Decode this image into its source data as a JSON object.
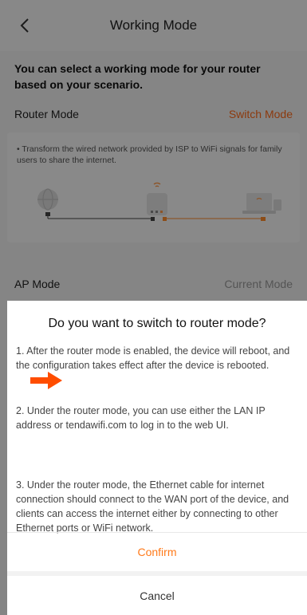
{
  "header": {
    "title": "Working Mode",
    "back_icon": "chevron-left-icon"
  },
  "intro_text": "You can select a working mode for your router based on your scenario.",
  "router_mode": {
    "label": "Router Mode",
    "action": "Switch Mode",
    "description": "• Transform the wired network provided by ISP to WiFi signals for family users to share the internet."
  },
  "ap_mode": {
    "label": "AP Mode",
    "status": "Current Mode"
  },
  "dialog": {
    "title": "Do you want to switch to router mode?",
    "paragraphs": [
      "1. After the router mode is enabled, the device will reboot, and the configuration takes effect after the device is rebooted.",
      "2. Under the router mode, you can use either the LAN IP address or tendawifi.com to log in to the web UI.",
      "3. Under the router mode, the Ethernet cable for internet connection should connect to the WAN port of the device, and clients can access the internet either by connecting to other Ethernet ports or WiFi network."
    ],
    "confirm_label": "Confirm",
    "cancel_label": "Cancel"
  },
  "colors": {
    "accent": "#ff6a1a",
    "annotation_arrow": "#ff4d00"
  }
}
